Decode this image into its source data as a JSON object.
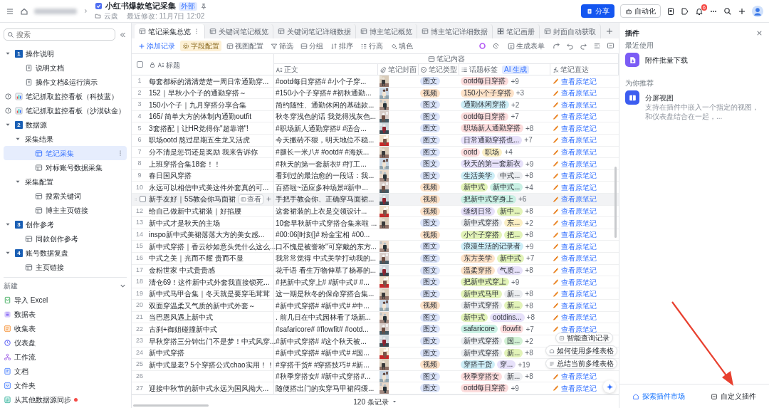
{
  "header": {
    "title": "小红书爆款笔记采集",
    "badge": "外部",
    "location": "云盘",
    "modified": "最近修改: 11月7日 12:02",
    "share": "分享",
    "automation": "自动化",
    "notifications": "6"
  },
  "sidebar": {
    "search": {
      "placeholder": "搜索"
    },
    "items": [
      {
        "label": "操作说明",
        "kind": "section",
        "number": "1",
        "expanded": true,
        "selected": false,
        "children": [
          {
            "label": "说明文档",
            "kind": "doc",
            "selected": false
          },
          {
            "label": "操作文档&运行演示",
            "kind": "doc",
            "selected": false
          }
        ]
      },
      {
        "label": "笔记抓取监控看板（科技蓝）",
        "kind": "dashboard",
        "selected": false
      },
      {
        "label": "笔记抓取监控看板（沙漠钛金）",
        "kind": "dashboard",
        "selected": false
      },
      {
        "label": "数据源",
        "kind": "section",
        "number": "2",
        "expanded": true,
        "selected": false,
        "children": [
          {
            "label": "采集结果",
            "kind": "group",
            "expanded": true,
            "selected": false,
            "children": [
              {
                "label": "笔记采集",
                "kind": "table",
                "selected": true
              },
              {
                "label": "对标账号数据采集",
                "kind": "table",
                "selected": false
              }
            ]
          },
          {
            "label": "采集配置",
            "kind": "group",
            "expanded": true,
            "selected": false,
            "children": [
              {
                "label": "搜索关键词",
                "kind": "table",
                "selected": false
              },
              {
                "label": "博主主页链接",
                "kind": "table",
                "selected": false
              }
            ]
          }
        ]
      },
      {
        "label": "创作参考",
        "kind": "section",
        "number": "3",
        "expanded": true,
        "selected": false,
        "children": [
          {
            "label": "同款创作参考",
            "kind": "table",
            "selected": false
          }
        ]
      },
      {
        "label": "账号数据复盘",
        "kind": "section",
        "number": "4",
        "expanded": true,
        "selected": false,
        "children": [
          {
            "label": "主页链接",
            "kind": "table",
            "selected": false
          }
        ]
      }
    ],
    "new_section": {
      "label": "新建",
      "expanded": true,
      "items": [
        {
          "label": "导入 Excel",
          "kind": "excel",
          "dot": false
        },
        {
          "label": "数据表",
          "kind": "sheet",
          "dot": false
        },
        {
          "label": "收集表",
          "kind": "form",
          "dot": false
        },
        {
          "label": "仪表盘",
          "kind": "dashboard",
          "dot": false
        },
        {
          "label": "工作流",
          "kind": "workflow",
          "dot": false
        },
        {
          "label": "文档",
          "kind": "doc",
          "dot": false
        },
        {
          "label": "文件夹",
          "kind": "folder",
          "dot": false
        },
        {
          "label": "从其他数据源同步",
          "kind": "sync",
          "dot": true
        }
      ]
    }
  },
  "tabs": [
    {
      "label": "笔记采集总览",
      "kind": "table",
      "selected": true
    },
    {
      "label": "关键词笔记概览",
      "kind": "table",
      "selected": false
    },
    {
      "label": "关键词笔记详细数据",
      "kind": "table",
      "selected": false
    },
    {
      "label": "博主笔记概览",
      "kind": "table",
      "selected": false
    },
    {
      "label": "博主笔记详细数据",
      "kind": "table",
      "selected": false
    },
    {
      "label": "笔记画册",
      "kind": "gallery",
      "selected": false
    },
    {
      "label": "封面自动获取",
      "kind": "table",
      "selected": false
    }
  ],
  "toolbar": {
    "items": [
      {
        "label": "添加记录",
        "kind": "add",
        "active": false
      },
      {
        "label": "字段配置",
        "kind": "fields",
        "active": true
      },
      {
        "label": "视图配置",
        "kind": "view",
        "active": false
      },
      {
        "label": "筛选",
        "kind": "filter",
        "active": false
      },
      {
        "label": "分组",
        "kind": "group",
        "active": false
      },
      {
        "label": "排序",
        "kind": "sort",
        "active": false
      },
      {
        "label": "行高",
        "kind": "rowheight",
        "active": false
      },
      {
        "label": "填色",
        "kind": "fill",
        "active": false
      }
    ],
    "generate_form": "生成表单"
  },
  "table": {
    "group_header": "笔记内容",
    "columns": [
      {
        "label": "标题",
        "kind": "title"
      },
      {
        "label": "正文",
        "kind": "ai"
      },
      {
        "label": "笔记封面",
        "kind": "attachment"
      },
      {
        "label": "笔记类型",
        "kind": "select"
      },
      {
        "label": "话题标签",
        "kind": "multi",
        "badge": "AI 生成"
      },
      {
        "label": "笔记直达",
        "kind": "formula"
      }
    ],
    "rows": [
      {
        "number": "1",
        "title": "每套都标的清清楚楚一周日常通勤穿...",
        "body": "#ootd每日穿搭# #小个子穿...",
        "cover": {
          "kind": "picture"
        },
        "type": {
          "label": "图文",
          "color": "#dce5fb"
        },
        "tags": [
          {
            "label": "ootd每日穿搭",
            "color": "#fcdcdc"
          }
        ],
        "more": "+9",
        "link": "查看原笔记",
        "highlighted": false
      },
      {
        "number": "2",
        "title": "152｜早秋小个子的通勤穿搭～",
        "body": "#150小个子穿搭# #初秋通勤...",
        "cover": {
          "kind": "picture"
        },
        "type": {
          "label": "视频",
          "color": "#fde2c8"
        },
        "tags": [
          {
            "label": "150小个子穿搭",
            "color": "#fde2c8"
          }
        ],
        "more": "+3",
        "link": "查看原笔记",
        "highlighted": false
      },
      {
        "number": "3",
        "title": "150小个子｜九月穿搭分享合集",
        "body": "简约随性、通勤休闲的基础款...",
        "cover": {
          "kind": "picture"
        },
        "type": {
          "label": "图文",
          "color": "#dce5fb"
        },
        "tags": [
          {
            "label": "通勤休闲穿搭",
            "color": "#cdeef7"
          }
        ],
        "more": "+2",
        "link": "查看原笔记",
        "highlighted": false
      },
      {
        "number": "4",
        "title": "165/ 简单大方的体制内通勤outfit",
        "body": "秋冬穿浅色的话 我觉得浅灰色...",
        "cover": {
          "kind": "picture"
        },
        "type": {
          "label": "图文",
          "color": "#dce5fb"
        },
        "tags": [
          {
            "label": "ootd每日穿搭",
            "color": "#fcdcdc"
          }
        ],
        "more": "+7",
        "link": "查看原笔记",
        "highlighted": false
      },
      {
        "number": "5",
        "title": "3套搭配｜让HR觉得你\"超靠谱\"!",
        "body": "#职场新人通勤穿搭# #适合...",
        "cover": {
          "kind": "picture"
        },
        "type": {
          "label": "图文",
          "color": "#dce5fb"
        },
        "tags": [
          {
            "label": "职场新人通勤穿搭",
            "color": "#fcdcdc"
          }
        ],
        "more": "+8",
        "link": "查看原笔记",
        "highlighted": false
      },
      {
        "number": "6",
        "title": "职场ootd 熬过星期五生龙又活虎",
        "body": "今天搬砖不狠，明天地位不稳...",
        "cover": {
          "kind": "picture"
        },
        "type": {
          "label": "图文",
          "color": "#dce5fb"
        },
        "tags": [
          {
            "label": "日常通勤穿搭也...",
            "color": "#e7e1fa"
          }
        ],
        "more": "+7",
        "link": "查看原笔记",
        "highlighted": false
      },
      {
        "number": "7",
        "title": "分不清是惩罚还是奖励 我来告诉你",
        "body": "#腿长一米八# #ootd# #海妖...",
        "cover": {
          "kind": "picture"
        },
        "type": {
          "label": "图文",
          "color": "#dce5fb"
        },
        "tags": [
          {
            "label": "ootd",
            "color": "#fcdcdc"
          },
          {
            "label": "职场",
            "color": "#fbefc4"
          }
        ],
        "more": "+4",
        "link": "查看原笔记",
        "highlighted": false
      },
      {
        "number": "8",
        "title": "上班穿搭合集18套！！",
        "body": "#秋天的第一套新衣# #打工...",
        "cover": {
          "kind": "picture"
        },
        "type": {
          "label": "图文",
          "color": "#dce5fb"
        },
        "tags": [
          {
            "label": "秋天的第一套新衣",
            "color": "#e7e1fa"
          }
        ],
        "more": "+9",
        "link": "查看原笔记",
        "highlighted": false
      },
      {
        "number": "9",
        "title": "春日国风穿搭",
        "body": "看到过的最治愈的一段话：我...",
        "cover": {
          "kind": "picture"
        },
        "type": {
          "label": "图文",
          "color": "#dce5fb"
        },
        "tags": [
          {
            "label": "生活美学",
            "color": "#cdeef7"
          },
          {
            "label": "中式...",
            "color": "#eceef1"
          }
        ],
        "more": "+8",
        "link": "查看原笔记",
        "highlighted": false
      },
      {
        "number": "10",
        "title": "永远可以相信中式美这件外套真的可...",
        "body": "百搭啦~适应多种场景#新中...",
        "cover": {
          "kind": "picture"
        },
        "type": {
          "label": "视频",
          "color": "#fde2c8"
        },
        "tags": [
          {
            "label": "新中式",
            "color": "#e2f3b8"
          },
          {
            "label": "新中式...",
            "color": "#c9f0e4"
          }
        ],
        "more": "+4",
        "link": "查看原笔记",
        "highlighted": false
      },
      {
        "title": "新手友好｜5S教会你马面裙",
        "open_button": "查看",
        "body": "手把手教会你、正确穿马面裙...",
        "cover": {
          "kind": "picture"
        },
        "type": {
          "label": "视频",
          "color": "#fde2c8"
        },
        "tags": [
          {
            "label": "把新中式穿身上",
            "color": "#c9f0e4"
          }
        ],
        "more": "+6",
        "link": "查看原笔记",
        "highlighted": true
      },
      {
        "number": "12",
        "title": "给自己做新中式裙装｜好掐腰",
        "body": "这套裙装的上衣是交领设计...",
        "cover": {
          "kind": "picture"
        },
        "type": {
          "label": "视频",
          "color": "#fde2c8"
        },
        "tags": [
          {
            "label": "缝纫日常",
            "color": "#e7e1fa"
          },
          {
            "label": "新中...",
            "color": "#e2f3b8"
          }
        ],
        "more": "+8",
        "link": "查看原笔记",
        "highlighted": false
      },
      {
        "number": "13",
        "title": "新中式才是秋天的主场",
        "body": "10套早秋新中式穿搭合集来啦 ...",
        "cover": {
          "kind": "picture"
        },
        "type": {
          "label": "图文",
          "color": "#dce5fb"
        },
        "tags": [
          {
            "label": "新中式穿搭",
            "color": "#eceef1"
          },
          {
            "label": "东...",
            "color": "#fbefc4"
          }
        ],
        "more": "+2",
        "link": "查看原笔记",
        "highlighted": false
      },
      {
        "number": "14",
        "title": "inspo新中式美裙落落大方的美女感...",
        "body": "#00:06[时刻]# 粉金宝相 #00...",
        "type": {
          "label": "视频",
          "color": "#fde2c8"
        },
        "tags": [
          {
            "label": "小个子穿搭",
            "color": "#e2f3b8"
          },
          {
            "label": "把...",
            "color": "#e2f3b8"
          }
        ],
        "more": "+8",
        "link": "查看原笔记",
        "highlighted": false
      },
      {
        "number": "15",
        "title": "新中式穿搭｜香云纱如意头凭什么这么...",
        "body": "口不愧是被誉称\"可穿戴的东方...",
        "cover": {
          "kind": "picture"
        },
        "type": {
          "label": "图文",
          "color": "#dce5fb"
        },
        "tags": [
          {
            "label": "浪漫生活的记录者",
            "color": "#cdeef7"
          }
        ],
        "more": "+9",
        "link": "查看原笔记",
        "highlighted": false
      },
      {
        "number": "16",
        "title": "中式之美｜光而不耀 贵而不显",
        "body": "我常常觉得 中式美学打动我的...",
        "cover": {
          "kind": "picture"
        },
        "type": {
          "label": "图文",
          "color": "#dce5fb"
        },
        "tags": [
          {
            "label": "东方美学",
            "color": "#fde2c8"
          },
          {
            "label": "新中式",
            "color": "#e2f3b8"
          }
        ],
        "more": "+7",
        "link": "查看原笔记",
        "highlighted": false
      },
      {
        "number": "17",
        "title": "金粉世家 中式贵贵感",
        "body": "花千语 看生万物伸草了杨幂的...",
        "cover": {
          "kind": "picture"
        },
        "type": {
          "label": "图文",
          "color": "#dce5fb"
        },
        "tags": [
          {
            "label": "温柔穿搭",
            "color": "#fde2c8"
          },
          {
            "label": "气质...",
            "color": "#e7e1fa"
          }
        ],
        "more": "+8",
        "link": "查看原笔记",
        "highlighted": false
      },
      {
        "number": "18",
        "title": "清仓69！这件新中式外套我直接锁死...",
        "body": "#把新中式穿上# #新中式# #...",
        "cover": {
          "kind": "picture"
        },
        "type": {
          "label": "图文",
          "color": "#dce5fb"
        },
        "tags": [
          {
            "label": "把新中式穿上",
            "color": "#e2f3b8"
          }
        ],
        "more": "+9",
        "link": "查看原笔记",
        "highlighted": false
      },
      {
        "number": "19",
        "title": "新中式马甲合集｜冬天就是要穿毛茸茸",
        "body": "这一期是秋冬的保命穿搭合集...",
        "cover": {
          "kind": "picture"
        },
        "type": {
          "label": "图文",
          "color": "#dce5fb"
        },
        "tags": [
          {
            "label": "新中式马甲",
            "color": "#e2f3b8"
          },
          {
            "label": "新...",
            "color": "#eceef1"
          }
        ],
        "more": "+8",
        "link": "查看原笔记",
        "highlighted": false
      },
      {
        "number": "20",
        "title": "双面穿温柔又气质的新中式外套～",
        "body": "#新中式穿搭# #新中式# #中...",
        "cover": {
          "kind": "picture"
        },
        "type": {
          "label": "视频",
          "color": "#fde2c8"
        },
        "tags": [
          {
            "label": "新中式穿搭",
            "color": "#eceef1"
          },
          {
            "label": "新...",
            "color": "#e2f3b8"
          }
        ],
        "more": "+8",
        "link": "查看原笔记",
        "highlighted": false
      },
      {
        "number": "21",
        "title": "当巴恩风遇上新中式",
        "body": ". 前几日在中式园林看了场新...",
        "cover": {
          "kind": "picture"
        },
        "type": {
          "label": "图文",
          "color": "#dce5fb"
        },
        "tags": [
          {
            "label": "新中式",
            "color": "#e2f3b8"
          },
          {
            "label": "ootdins...",
            "color": "#e7e1fa"
          }
        ],
        "more": "+8",
        "link": "查看原笔记",
        "highlighted": false
      },
      {
        "number": "22",
        "title": "古刹+御姐碰撞新中式",
        "body": "#safaricore# #flowfit# #ootd...",
        "cover": {
          "kind": "picture"
        },
        "type": {
          "label": "图文",
          "color": "#dce5fb"
        },
        "tags": [
          {
            "label": "safaricore",
            "color": "#c9f0e4"
          },
          {
            "label": "flowfit",
            "color": "#fcdcdc"
          }
        ],
        "more": "+7",
        "link": "查看原笔记",
        "highlighted": false
      },
      {
        "number": "23",
        "title": "早秋穿搭三分钟出门不是梦！中式风穿...",
        "body": "#新中式穿搭# #这个秋天被...",
        "cover": {
          "kind": "picture"
        },
        "type": {
          "label": "图文",
          "color": "#dce5fb"
        },
        "tags": [
          {
            "label": "新中式穿搭",
            "color": "#eceef1"
          },
          {
            "label": "国...",
            "color": "#d2f1d4"
          }
        ],
        "more": "+2",
        "highlighted": false
      },
      {
        "number": "24",
        "title": "新中式穿搭",
        "body": "#新中式穿搭# #新中式# #国...",
        "cover": {
          "kind": "picture"
        },
        "type": {
          "label": "图文",
          "color": "#dce5fb"
        },
        "tags": [
          {
            "label": "新中式穿搭",
            "color": "#eceef1"
          },
          {
            "label": "新...",
            "color": "#e2f3b8"
          }
        ],
        "more": "+8",
        "highlighted": false
      },
      {
        "number": "25",
        "title": "新中式显老? 5个穿搭公式chao实用！！",
        "body": "#穿搭干货# #穿搭技巧# #新...",
        "cover": {
          "kind": "picture"
        },
        "type": {
          "label": "视频",
          "color": "#fde2c8"
        },
        "tags": [
          {
            "label": "穿搭干货",
            "color": "#cdeef7"
          },
          {
            "label": "穿...",
            "color": "#e7e1fa"
          }
        ],
        "more": "+19",
        "highlighted": false
      },
      {
        "number": "26",
        "body": "#秋季穿搭女# #新中式穿搭#...",
        "cover": {
          "kind": "picture"
        },
        "type": {
          "label": "图文",
          "color": "#dce5fb"
        },
        "tags": [
          {
            "label": "秋季穿搭女",
            "color": "#fcdcdc"
          },
          {
            "label": "新...",
            "color": "#eceef1"
          }
        ],
        "more": "+8",
        "link": "查看原笔记",
        "highlighted": false
      },
      {
        "number": "27",
        "title": "迎接中秋节的新中式永远为国风拗大...",
        "body": "随便搭出门的实穿马甲裙闷缓...",
        "cover": {
          "kind": "picture"
        },
        "type": {
          "label": "图文",
          "color": "#dce5fb"
        },
        "tags": [
          {
            "label": "ootd每日穿搭",
            "color": "#fcdcdc"
          }
        ],
        "more": "+9",
        "link": "查看原笔记",
        "highlighted": false
      }
    ],
    "record_count": "120 条记录",
    "select_all": {
      "checked": false
    }
  },
  "assistant": {
    "suggestions": [
      {
        "label": "智能查询记录",
        "kind": "query"
      },
      {
        "label": "如何使用多维表格",
        "kind": "help"
      },
      {
        "label": "总结当前多维表格",
        "kind": "summary"
      }
    ]
  },
  "plugins": {
    "title": "插件",
    "recent_label": "最近使用",
    "recent": [
      {
        "name": "附件批量下载",
        "kind": "download"
      }
    ],
    "recommend_label": "为你推荐",
    "recommended": [
      {
        "name": "分屏视图",
        "kind": "split",
        "description": "支持在插件中嵌入一个指定的视图，和仪表盘结合在一起，..."
      }
    ],
    "explore": "探索插件市场",
    "custom": "自定义插件"
  },
  "annotation": {
    "kind": "arrow"
  }
}
